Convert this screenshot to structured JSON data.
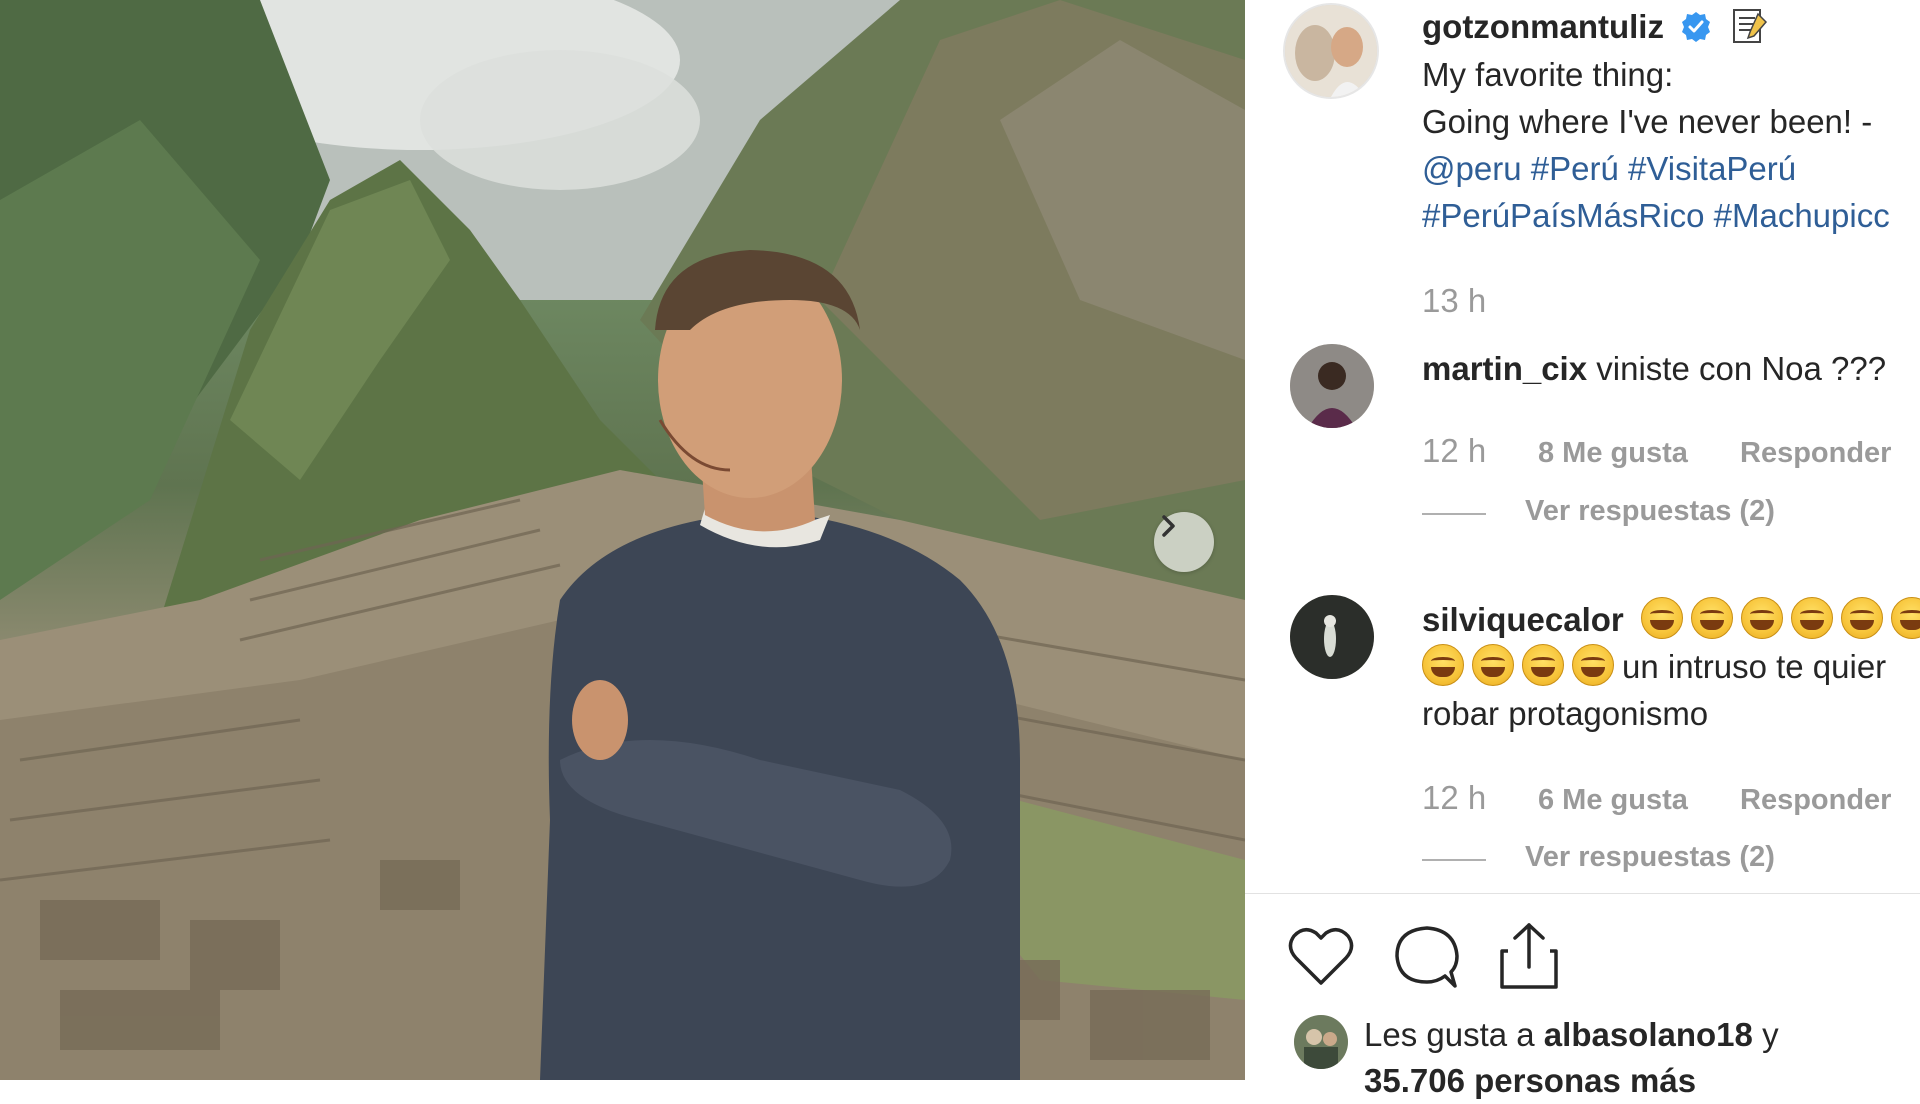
{
  "post": {
    "username": "gotzonmantuliz",
    "caption_lines": [
      "My favorite thing:",
      "Going where I've never been! -"
    ],
    "tags_line1": [
      "@peru",
      "#Perú",
      "#VisitaPerú"
    ],
    "tags_line2": [
      "#PerúPaísMásRico",
      "#Machupicc"
    ],
    "time": "13 h"
  },
  "comments": [
    {
      "username": "martin_cix",
      "text": "viniste con Noa ???",
      "time": "12 h",
      "likes": "8 Me gusta",
      "reply": "Responder",
      "view_replies": "Ver respuestas (2)"
    },
    {
      "username": "silviquecalor",
      "text_line2": "un intruso te quier",
      "text_line3": "robar protagonismo",
      "time": "12 h",
      "likes": "6 Me gusta",
      "reply": "Responder",
      "view_replies": "Ver respuestas (2)"
    }
  ],
  "likes_summary": {
    "prefix": "Les gusta a",
    "user": "albasolano18",
    "suffix": "y",
    "count_line": "35.706 personas más"
  },
  "icons": {
    "verified": "verified-badge-icon",
    "note": "memo-icon",
    "heart": "heart-icon",
    "comment": "comment-icon",
    "share": "share-icon",
    "next": "chevron-right-icon"
  },
  "colors": {
    "link": "#2f5e96",
    "verified": "#3897f0",
    "muted": "#9a9a9a"
  }
}
